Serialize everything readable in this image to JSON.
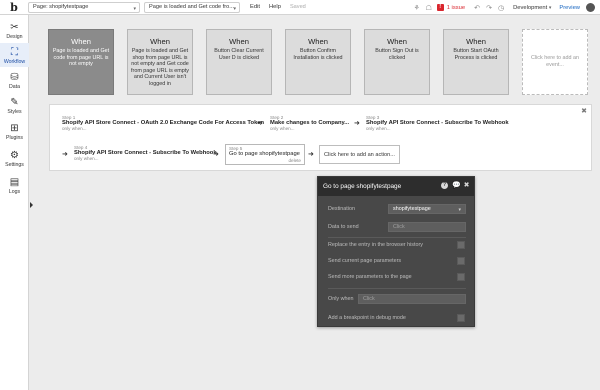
{
  "topbar": {
    "logo": "b",
    "page_select": "Page: shopifytestpage",
    "workflow_select": "Page is loaded and Get code fro...",
    "menu_edit": "Edit",
    "menu_help": "Help",
    "saved_status": "Saved",
    "issues": "1 issue",
    "branch": "Development",
    "preview": "Preview"
  },
  "sidebar": {
    "items": [
      {
        "label": "Design",
        "icon": "design-icon"
      },
      {
        "label": "Workflow",
        "icon": "workflow-icon"
      },
      {
        "label": "Data",
        "icon": "data-icon"
      },
      {
        "label": "Styles",
        "icon": "styles-icon"
      },
      {
        "label": "Plugins",
        "icon": "plugins-icon"
      },
      {
        "label": "Settings",
        "icon": "settings-icon"
      },
      {
        "label": "Logs",
        "icon": "logs-icon"
      }
    ],
    "active": "Workflow"
  },
  "events": [
    {
      "when": "When",
      "desc": "Page is loaded and Get code from page URL is not empty",
      "selected": true
    },
    {
      "when": "When",
      "desc": "Page is loaded and Get shop from page URL is not empty and Get code from page URL is empty and Current User isn't logged in",
      "selected": false
    },
    {
      "when": "When",
      "desc": "Button Clear Current User D is clicked",
      "selected": false
    },
    {
      "when": "When",
      "desc": "Button Confirm Installation is clicked",
      "selected": false
    },
    {
      "when": "When",
      "desc": "Button Sign Out is clicked",
      "selected": false
    },
    {
      "when": "When",
      "desc": "Button Start OAuth Process is clicked",
      "selected": false
    }
  ],
  "add_event": "Click here to add an event...",
  "steps": [
    {
      "num": "Step 1",
      "title": "Shopify API Store Connect - OAuth 2.0 Exchange Code For Access Token",
      "sub": "only when..."
    },
    {
      "num": "Step 2",
      "title": "Make changes to Company...",
      "sub": "only when..."
    },
    {
      "num": "Step 3",
      "title": "Shopify API Store Connect - Subscribe To Webhook",
      "sub": "only when..."
    },
    {
      "num": "Step 4",
      "title": "Shopify API Store Connect - Subscribe To Webhook",
      "sub": "only when..."
    },
    {
      "num": "Step 5",
      "title": "Go to page shopifytestpage",
      "sub": "delete"
    }
  ],
  "add_action": "Click here to add an action...",
  "editor": {
    "title": "Go to page shopifytestpage",
    "destination_label": "Destination",
    "destination_value": "shopifytestpage",
    "data_to_send_label": "Data to send",
    "data_to_send_placeholder": "Click",
    "replace_entry_label": "Replace the entry in the browser history",
    "send_params_label": "Send current page parameters",
    "send_more_label": "Send more parameters to the page",
    "only_when_label": "Only when",
    "only_when_placeholder": "Click",
    "breakpoint_label": "Add a breakpoint in debug mode"
  }
}
